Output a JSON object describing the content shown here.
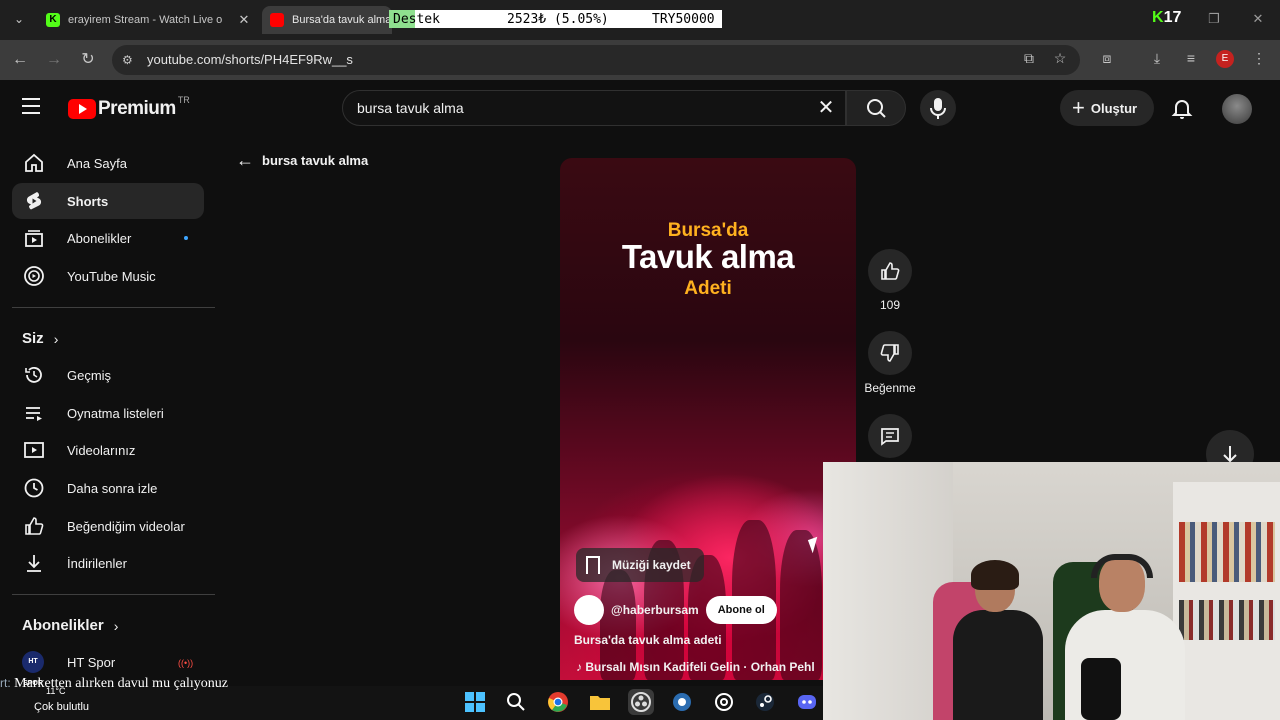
{
  "browser": {
    "tabs": [
      {
        "title": "erayirem Stream - Watch Live o",
        "close": "✕"
      },
      {
        "title": "Bursa'da tavuk alma",
        "close": "✕"
      }
    ],
    "url": "youtube.com/shorts/PH4EF9Rw__s",
    "profile_initial": "E"
  },
  "stream_overlay": {
    "label": "Destek",
    "amount": "2523₺ (5.05%)",
    "goal": "TRY50000",
    "progress_fraction": 0.0505,
    "kick_badge": "K",
    "kick_number": "17"
  },
  "youtube": {
    "logo_text": "Premium",
    "country_code": "TR",
    "search_query": "bursa tavuk alma",
    "create_label": "Oluştur"
  },
  "sidebar": {
    "main": [
      {
        "label": "Ana Sayfa",
        "icon": "home-icon"
      },
      {
        "label": "Shorts",
        "icon": "shorts-icon"
      },
      {
        "label": "Abonelikler",
        "icon": "subscriptions-icon"
      },
      {
        "label": "YouTube Music",
        "icon": "youtube-music-icon"
      }
    ],
    "you_header": "Siz",
    "you": [
      {
        "label": "Geçmiş",
        "icon": "history-icon"
      },
      {
        "label": "Oynatma listeleri",
        "icon": "playlists-icon"
      },
      {
        "label": "Videolarınız",
        "icon": "your-videos-icon"
      },
      {
        "label": "Daha sonra izle",
        "icon": "watch-later-icon"
      },
      {
        "label": "Beğendiğim videolar",
        "icon": "liked-videos-icon"
      },
      {
        "label": "İndirilenler",
        "icon": "downloads-icon"
      }
    ],
    "subs_header": "Abonelikler",
    "subs": [
      {
        "label": "HT Spor",
        "avatar_text": "HT SPOR"
      }
    ]
  },
  "shorts": {
    "back_label": "bursa tavuk alma",
    "video_text": {
      "line1": "Bursa'da",
      "line2": "Tavuk alma",
      "line3": "Adeti"
    },
    "save_music_label": "Müziği kaydet",
    "channel": "@haberbursam",
    "subscribe_label": "Abone ol",
    "description": "Bursa'da tavuk alma adeti",
    "music": "Bursalı Mısın Kadifeli Gelin · Orhan Pehl",
    "likes": "109",
    "dislike_label": "Beğenme"
  },
  "taskbar": {
    "chat_prefix": "rt:",
    "chat_message": "Marketten alırken davul mu çalıyonuz",
    "weather_temp": "11°C",
    "weather_desc": "Çok bulutlu",
    "weather_prefix": "rt: 1D"
  },
  "colors": {
    "yt_red": "#ff0000",
    "bg": "#0f0f0f",
    "accent_blue": "#3ea6ff",
    "title_orange": "#ffb11f"
  }
}
